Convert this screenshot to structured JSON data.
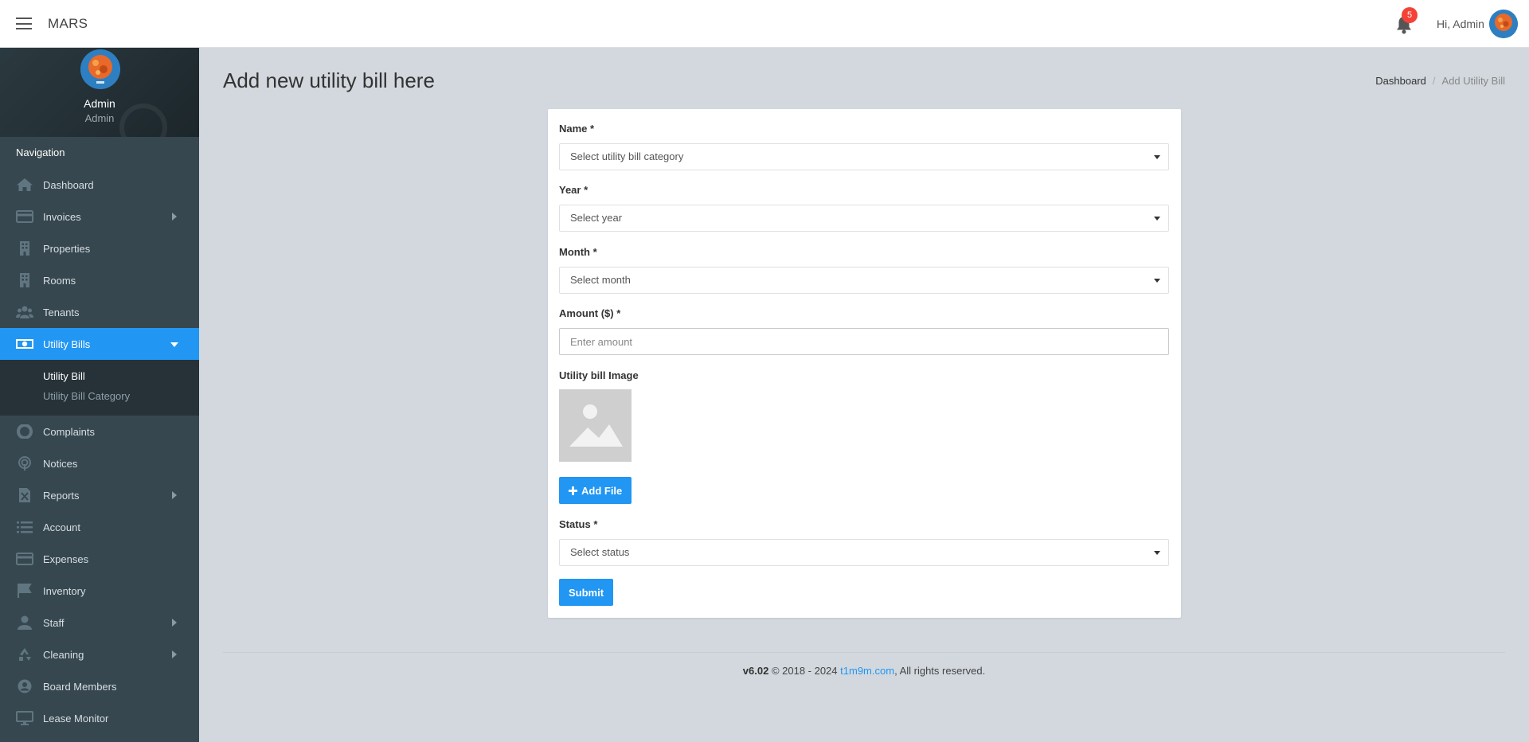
{
  "app": {
    "title": "MARS"
  },
  "header": {
    "notification_count": "5",
    "greeting": "Hi, Admin"
  },
  "sidebar": {
    "user": {
      "name": "Admin",
      "role": "Admin"
    },
    "nav_header": "Navigation",
    "items": [
      {
        "label": "Dashboard",
        "icon": "home-icon",
        "has_children": false
      },
      {
        "label": "Invoices",
        "icon": "credit-card-icon",
        "has_children": true
      },
      {
        "label": "Properties",
        "icon": "building-icon",
        "has_children": false
      },
      {
        "label": "Rooms",
        "icon": "building-icon",
        "has_children": false
      },
      {
        "label": "Tenants",
        "icon": "users-icon",
        "has_children": false
      },
      {
        "label": "Utility Bills",
        "icon": "money-icon",
        "has_children": true,
        "active": true,
        "children": [
          {
            "label": "Utility Bill",
            "current": true
          },
          {
            "label": "Utility Bill Category"
          }
        ]
      },
      {
        "label": "Complaints",
        "icon": "lifebuoy-icon",
        "has_children": false
      },
      {
        "label": "Notices",
        "icon": "podcast-icon",
        "has_children": false
      },
      {
        "label": "Reports",
        "icon": "file-excel-icon",
        "has_children": true
      },
      {
        "label": "Account",
        "icon": "list-icon",
        "has_children": false
      },
      {
        "label": "Expenses",
        "icon": "credit-card-icon",
        "has_children": false
      },
      {
        "label": "Inventory",
        "icon": "flask-icon",
        "has_children": false
      },
      {
        "label": "Staff",
        "icon": "user-icon",
        "has_children": true
      },
      {
        "label": "Cleaning",
        "icon": "recycle-icon",
        "has_children": true
      },
      {
        "label": "Board Members",
        "icon": "user-circle-icon",
        "has_children": false
      },
      {
        "label": "Lease Monitor",
        "icon": "desktop-icon",
        "has_children": false
      }
    ]
  },
  "page": {
    "title": "Add new utility bill here",
    "breadcrumb": [
      "Dashboard",
      "Add Utility Bill"
    ]
  },
  "form": {
    "name_label": "Name *",
    "name_value": "Select utility bill category",
    "year_label": "Year *",
    "year_value": "Select year",
    "month_label": "Month *",
    "month_value": "Select month",
    "amount_label": "Amount ($) *",
    "amount_placeholder": "Enter amount",
    "image_label": "Utility bill Image",
    "add_file_label": "Add File",
    "status_label": "Status *",
    "status_value": "Select status",
    "submit_label": "Submit"
  },
  "footer": {
    "version": "v6.02",
    "copyright": "© 2018 - 2024",
    "link": "t1m9m.com",
    "rights": ", All rights reserved."
  },
  "colors": {
    "primary": "#2196f3",
    "sidebar": "#37474f",
    "badge": "#f44336",
    "background": "#d2d8de"
  }
}
